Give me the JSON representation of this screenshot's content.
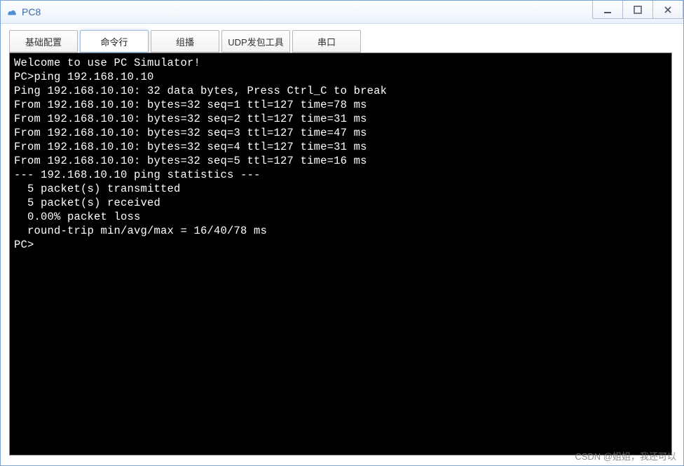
{
  "window": {
    "title": "PC8"
  },
  "controls": {
    "minimize": "–",
    "maximize": "□",
    "close": "X"
  },
  "tabs": [
    {
      "label": "基础配置"
    },
    {
      "label": "命令行"
    },
    {
      "label": "组播"
    },
    {
      "label": "UDP发包工具"
    },
    {
      "label": "串口"
    }
  ],
  "active_tab_index": 1,
  "terminal": {
    "lines": [
      "Welcome to use PC Simulator!",
      "",
      "PC>ping 192.168.10.10",
      "",
      "Ping 192.168.10.10: 32 data bytes, Press Ctrl_C to break",
      "From 192.168.10.10: bytes=32 seq=1 ttl=127 time=78 ms",
      "From 192.168.10.10: bytes=32 seq=2 ttl=127 time=31 ms",
      "From 192.168.10.10: bytes=32 seq=3 ttl=127 time=47 ms",
      "From 192.168.10.10: bytes=32 seq=4 ttl=127 time=31 ms",
      "From 192.168.10.10: bytes=32 seq=5 ttl=127 time=16 ms",
      "",
      "--- 192.168.10.10 ping statistics ---",
      "  5 packet(s) transmitted",
      "  5 packet(s) received",
      "  0.00% packet loss",
      "  round-trip min/avg/max = 16/40/78 ms",
      "",
      "PC>"
    ]
  },
  "watermark": "CSDN @姐姐，我还可以"
}
